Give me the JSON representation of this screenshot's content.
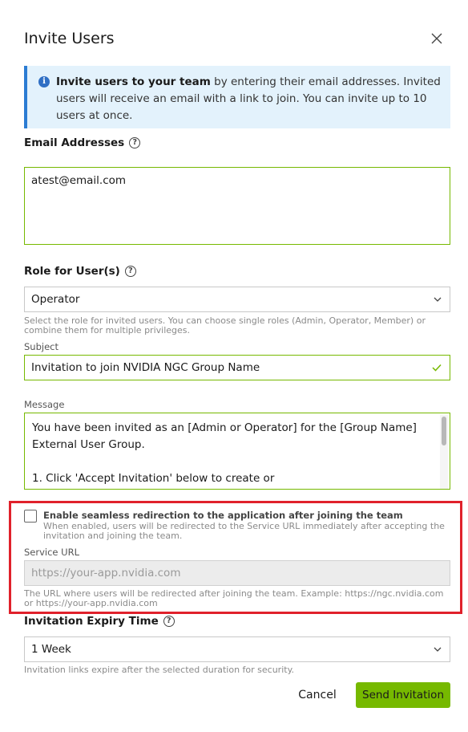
{
  "dialog": {
    "title": "Invite Users",
    "close_icon": "close-icon"
  },
  "info": {
    "icon": "info-icon",
    "bold": "Invite users to your team",
    "text": " by entering their email addresses. Invited users will receive an email with a link to join. You can invite up to 10 users at once."
  },
  "email": {
    "label": "Email Addresses",
    "value": "atest@email.com"
  },
  "role": {
    "label": "Role for User(s)",
    "value": "Operator",
    "hint": "Select the role for invited users. You can choose single roles (Admin, Operator, Member) or combine them for multiple privileges."
  },
  "subject": {
    "label": "Subject",
    "value": "Invitation to join NVIDIA NGC Group Name"
  },
  "message": {
    "label": "Message",
    "value": "You have been invited as an [Admin or Operator] for the [Group Name] External User Group.\n\n1. Click 'Accept Invitation' below to create or\n   sign in to your NVIDIA account."
  },
  "redirect": {
    "checkbox_label": "Enable seamless redirection to the application after joining the team",
    "checked": false,
    "description": "When enabled, users will be redirected to the Service URL immediately after accepting the invitation and joining the team.",
    "service_url_label": "Service URL",
    "service_url_placeholder": "https://your-app.nvidia.com",
    "service_url_hint": "The URL where users will be redirected after joining the team. Example: https://ngc.nvidia.com or https://your-app.nvidia.com"
  },
  "expiry": {
    "label": "Invitation Expiry Time",
    "value": "1 Week",
    "hint": "Invitation links expire after the selected duration for security."
  },
  "actions": {
    "cancel": "Cancel",
    "send": "Send Invitation"
  },
  "colors": {
    "accent": "#76b900",
    "info_border": "#2b7cd3",
    "highlight": "#e0212b"
  }
}
